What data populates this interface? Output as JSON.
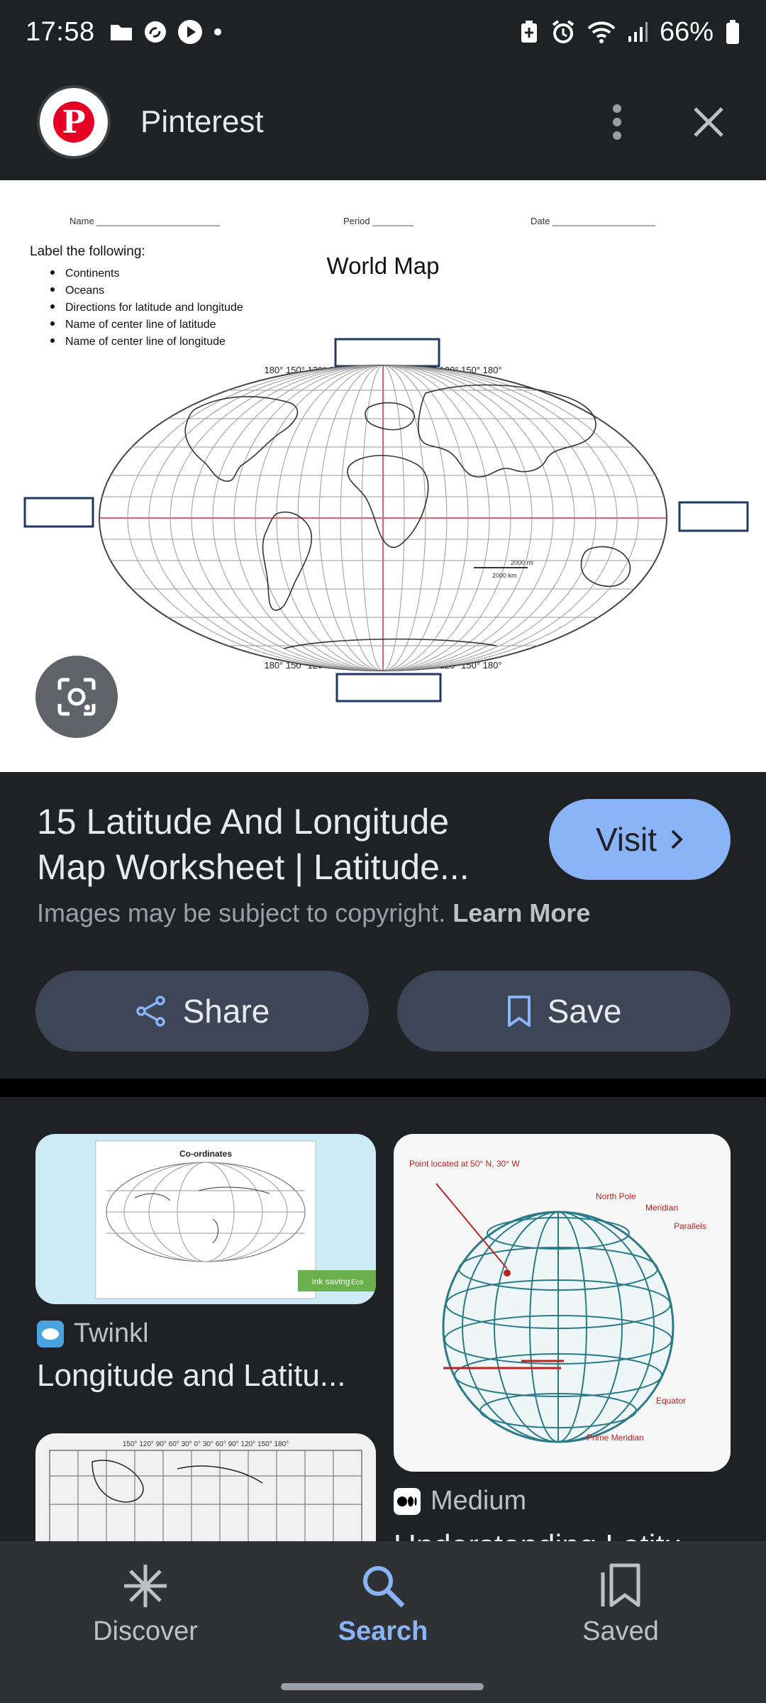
{
  "status_bar": {
    "time": "17:58",
    "battery": "66%"
  },
  "header": {
    "title": "Pinterest"
  },
  "worksheet": {
    "name_label": "Name ________________________",
    "period_label": "Period ________",
    "date_label": "Date ____________________",
    "instructions_heading": "Label the following:",
    "instructions": [
      "Continents",
      "Oceans",
      "Directions for latitude and longitude",
      "Name of center line of latitude",
      "Name of center line of longitude"
    ],
    "map_title": "World Map",
    "longitude_ticks": "180° 150° 120° 90° 60° 30° 0° 30° 60° 90° 120° 150° 180°",
    "scale_mi": "2000 mi",
    "scale_km": "2000 km"
  },
  "result": {
    "title": "15 Latitude And Longitude Map Worksheet | Latitude...",
    "visit_label": "Visit",
    "copyright_text": "Images may be subject to copyright.",
    "learn_more": "Learn More",
    "share_label": "Share",
    "save_label": "Save"
  },
  "related": [
    {
      "source": "Twinkl",
      "title": "Longitude and Latitu...",
      "image_heading": "Co-ordinates",
      "badge": "ink saving",
      "badge_tag": "Eco"
    },
    {
      "source": "Medium",
      "title": "Understanding Latitu...",
      "labels": {
        "point": "Point located at 50° N, 30° W",
        "north_pole": "North Pole",
        "meridian": "Meridian",
        "parallels": "Parallels",
        "equator": "Equator",
        "prime_meridian": "Prime Meridian"
      }
    },
    {
      "image_ticks": "150° 120° 90° 60° 30° 0° 30° 60° 90° 120° 150° 180°"
    }
  ],
  "bottom_nav": {
    "discover": "Discover",
    "search": "Search",
    "saved": "Saved"
  },
  "colors": {
    "background": "#202124",
    "accent": "#8ab4f8",
    "pinterest_red": "#e60023",
    "button_bg": "#3c4656"
  }
}
